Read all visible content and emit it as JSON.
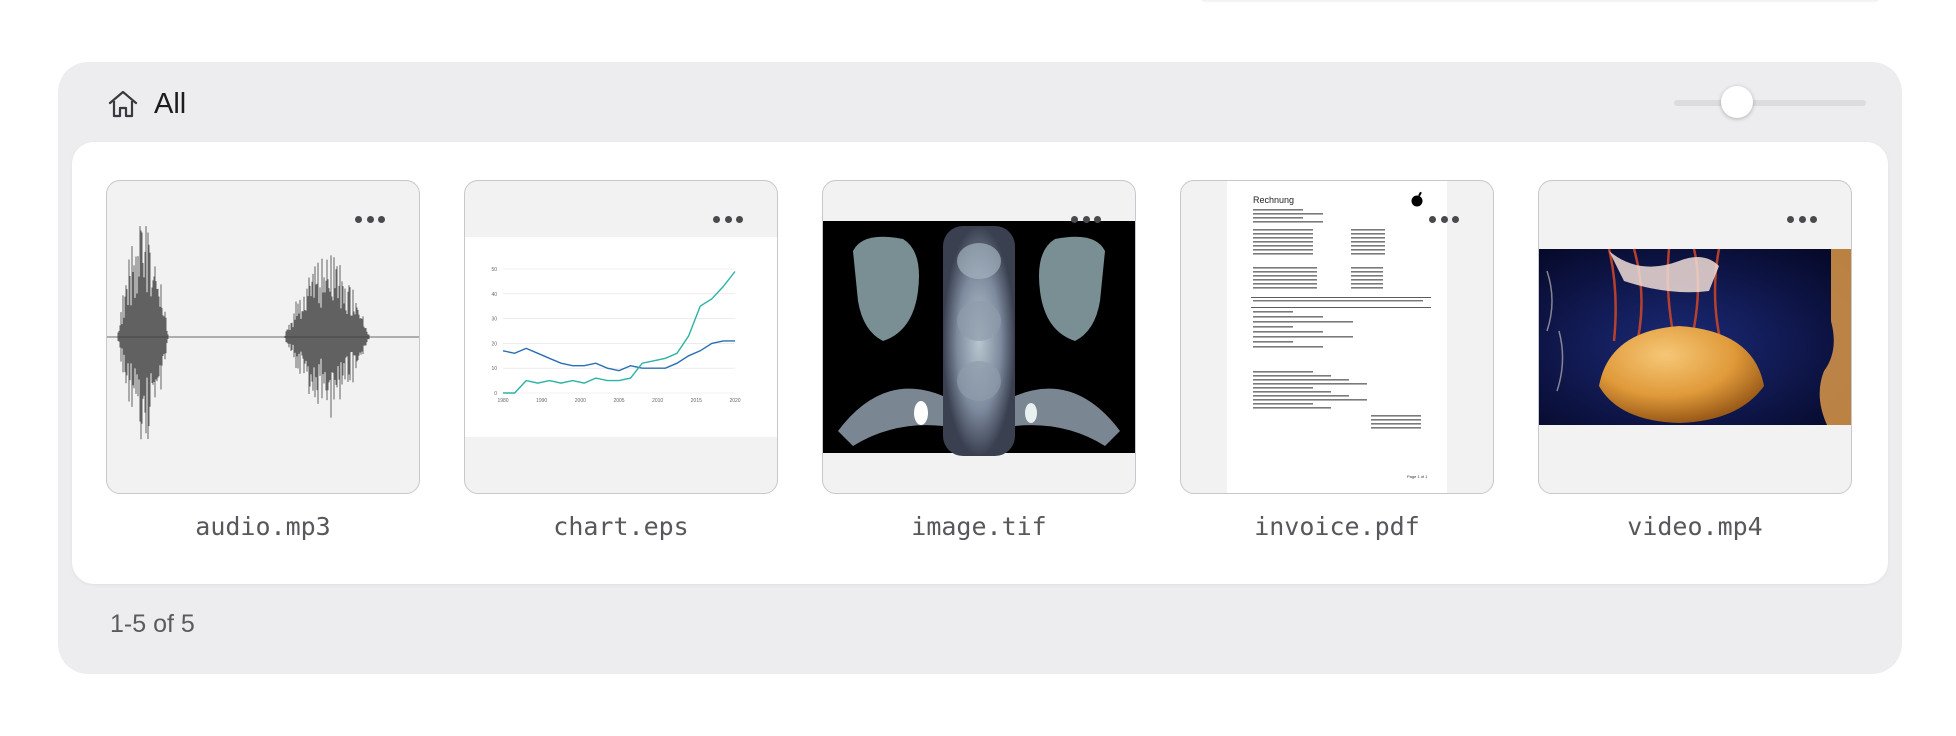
{
  "header": {
    "icon": "home-icon",
    "title": "All"
  },
  "zoom": {
    "value": 0.33
  },
  "files": [
    {
      "name": "audio.mp3",
      "preview": "waveform"
    },
    {
      "name": "chart.eps",
      "preview": "line-chart"
    },
    {
      "name": "image.tif",
      "preview": "ct-scan"
    },
    {
      "name": "invoice.pdf",
      "preview": "document"
    },
    {
      "name": "video.mp4",
      "preview": "jellyfish"
    }
  ],
  "chart_preview": {
    "x_ticks": [
      "1980",
      "1990",
      "2000",
      "2005",
      "2010",
      "2015",
      "2020"
    ],
    "y_ticks": [
      "0",
      "10",
      "20",
      "30",
      "40",
      "50"
    ]
  },
  "invoice_preview": {
    "heading": "Rechnung",
    "brand_icon": "apple-icon",
    "page_label": "Page 1 of 1"
  },
  "pagination": {
    "label": "1-5 of 5"
  },
  "colors": {
    "panel_bg": "#ededf0",
    "card_bg": "#ffffff",
    "chart_teal": "#2bb3a3",
    "chart_blue": "#2a6fb5"
  }
}
